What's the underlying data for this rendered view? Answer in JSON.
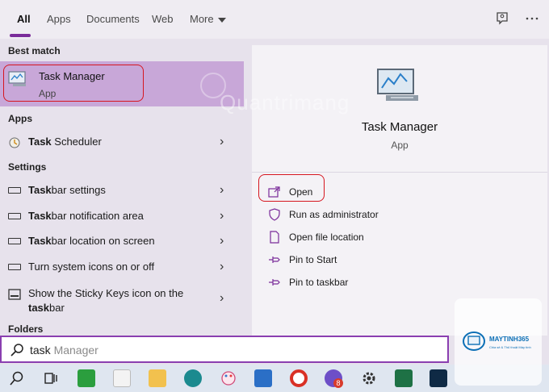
{
  "tabs": [
    "All",
    "Apps",
    "Documents",
    "Web",
    "More"
  ],
  "sections": {
    "best_match": "Best match",
    "apps": "Apps",
    "settings": "Settings",
    "folders": "Folders"
  },
  "best_match": {
    "title": "Task Manager",
    "subtitle": "App"
  },
  "apps": [
    {
      "bold": "Task",
      "rest": " Scheduler"
    }
  ],
  "settings": [
    {
      "bold": "Task",
      "rest": "bar settings"
    },
    {
      "bold": "Task",
      "rest": "bar notification area"
    },
    {
      "bold": "Task",
      "rest": "bar location on screen"
    },
    {
      "bold": "",
      "rest": "Turn system icons on or off"
    },
    {
      "line1": "Show the Sticky Keys icon on the",
      "bold": "task",
      "rest": "bar"
    }
  ],
  "detail": {
    "title": "Task Manager",
    "subtitle": "App",
    "actions": [
      "Open",
      "Run as administrator",
      "Open file location",
      "Pin to Start",
      "Pin to taskbar"
    ]
  },
  "search": {
    "typed": "task",
    "suggestion": " Manager"
  },
  "watermark": {
    "brand": "MAYTINH365",
    "tagline": "Chia sẻ & Thủ thuật Máy tính",
    "overlay": "Quantrimang"
  },
  "taskbar": {
    "badge": "8"
  },
  "colors": {
    "accent": "#7a2c9a",
    "highlight": "#c8a7d8",
    "callout": "#d6161f"
  }
}
